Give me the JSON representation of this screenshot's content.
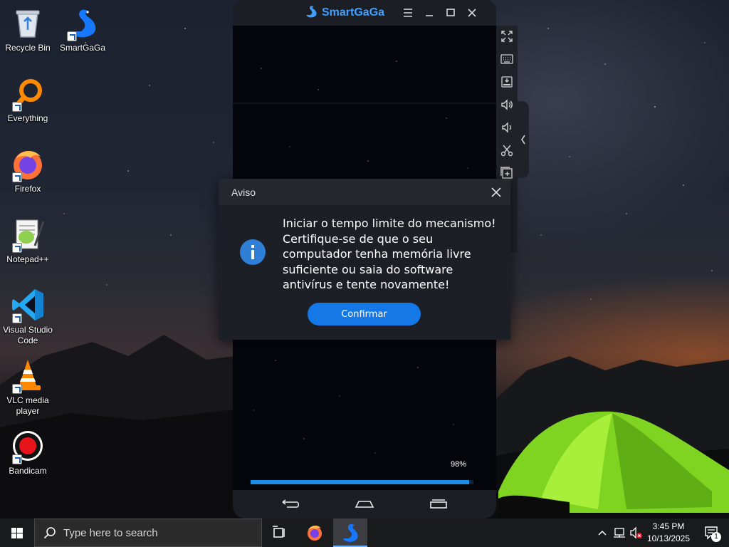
{
  "desktop": {
    "icons": [
      {
        "label": "Recycle Bin",
        "icon": "recycle-bin-icon"
      },
      {
        "label": "SmartGaGa",
        "icon": "smartgaga-swan-icon"
      },
      {
        "label": "Everything",
        "icon": "everything-magnifier-icon"
      },
      {
        "label": "Firefox",
        "icon": "firefox-icon"
      },
      {
        "label": "Notepad++",
        "icon": "notepadpp-icon"
      },
      {
        "label": "Visual Studio Code",
        "icon": "vscode-icon"
      },
      {
        "label": "VLC media player",
        "icon": "vlc-cone-icon"
      },
      {
        "label": "Bandicam",
        "icon": "bandicam-record-icon"
      }
    ]
  },
  "emulator": {
    "brand": "SmartGaGa",
    "accent_color": "#3fa0ff",
    "progress": {
      "label": "98%",
      "value": 0.98
    },
    "side_toolbar": [
      "fullscreen-icon",
      "keyboard-icon",
      "apk-install-icon",
      "volume-up-icon",
      "volume-down-icon",
      "screenshot-cut-icon",
      "multi-instance-icon"
    ]
  },
  "dialog": {
    "title": "Aviso",
    "message": "Iniciar o tempo limite do mecanismo! Certifique-se de que o seu computador tenha memória livre suficiente ou saia do software antivírus e tente novamente!",
    "confirm_label": "Confirmar",
    "button_color": "#1478e6"
  },
  "taskbar": {
    "search_placeholder": "Type here to search",
    "time": "3:45 PM",
    "date": "10/13/2025",
    "notification_count": "1"
  }
}
